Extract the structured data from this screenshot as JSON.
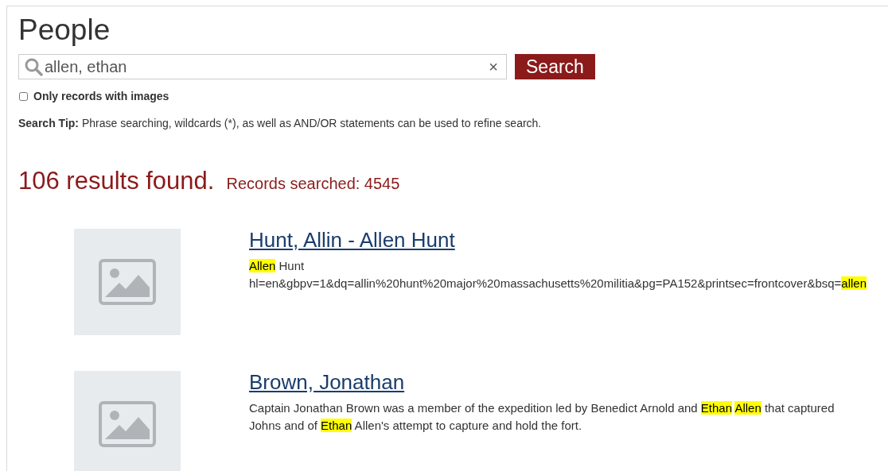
{
  "page_title": "People",
  "search": {
    "value": "allen, ethan",
    "clear_label": "×",
    "button": "Search"
  },
  "images_only": {
    "label": "Only records with images",
    "checked": false
  },
  "search_tip": "**Search Tip:** Phrase searching, wildcards (*), as well as AND/OR statements can be used to refine search.",
  "results_count": "106 results found.",
  "records_searched": "Records searched: 4545",
  "results": [
    {
      "title": "Hunt, Allin - Allen Hunt",
      "lines": [
        [
          {
            "text": "Allen",
            "highlighted": true
          },
          {
            "text": " Hunt",
            "highlighted": false
          }
        ],
        [
          {
            "text": "hl=en&gbpv=1&dq=allin%20hunt%20major%20massachusetts%20militia&pg=PA152&printsec=frontcover&bsq=",
            "highlighted": false
          },
          {
            "text": "allen",
            "highlighted": true
          }
        ]
      ]
    },
    {
      "title": "Brown, Jonathan",
      "lines": [
        [
          {
            "text": "Captain Jonathan Brown was a member of the expedition led by Benedict Arnold and ",
            "highlighted": false
          },
          {
            "text": "Ethan",
            "highlighted": true
          },
          {
            "text": "Allen",
            "highlighted": true,
            "space_before": true
          },
          {
            "text": " that captured Johns and of ",
            "highlighted": false
          },
          {
            "text": "Ethan",
            "highlighted": true
          },
          {
            "text": " Allen's attempt to capture and hold the fort.",
            "highlighted": false
          }
        ]
      ]
    }
  ]
}
